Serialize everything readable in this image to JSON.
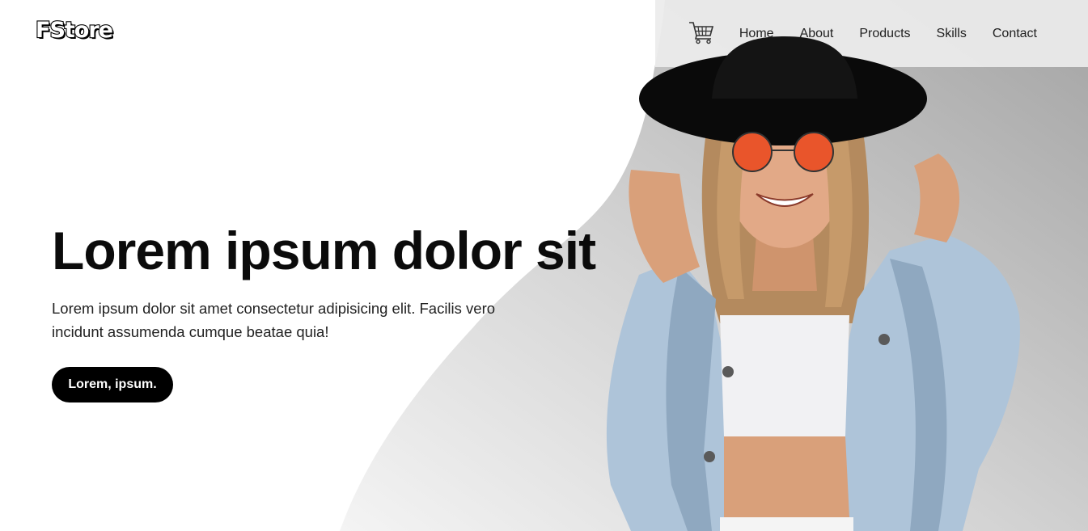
{
  "brand": {
    "logo_text": "FStore"
  },
  "nav": {
    "cart_icon": "shopping-cart-icon",
    "links": [
      "Home",
      "About",
      "Products",
      "Skills",
      "Contact"
    ]
  },
  "hero": {
    "title": "Lorem ipsum dolor sit",
    "description": "Lorem ipsum dolor sit amet consectetur adipisicing elit. Facilis vero incidunt assumenda cumque beatae quia!",
    "button_label": "Lorem, ipsum."
  },
  "colors": {
    "primary": "#000000",
    "background": "#ffffff",
    "shape_gray": "#a9a9a9",
    "navbar_bg": "#ececec"
  }
}
